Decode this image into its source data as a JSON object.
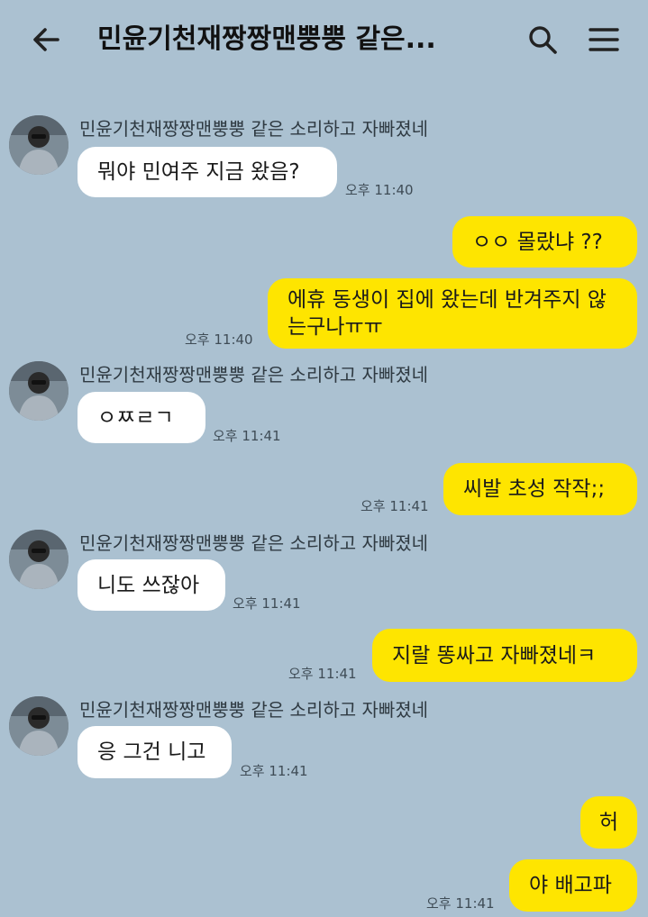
{
  "header": {
    "title": "민윤기천재짱짱맨뿡뿡 같은...",
    "back_icon": "arrow-left-icon",
    "search_icon": "search-icon",
    "menu_icon": "hamburger-menu-icon"
  },
  "colors": {
    "background": "#abc1d1",
    "incoming": "#ffffff",
    "outgoing": "#fee500"
  },
  "messages": [
    {
      "sender": "민윤기천재짱짱맨뿡뿡 같은 소리하고 자빠졌네",
      "text": "뭐야 민여주 지금 왔음?",
      "time": "오후 11:40"
    },
    {
      "text": "ㅇㅇ 몰랐냐 ??"
    },
    {
      "text": "에휴 동생이 집에 왔는데 반겨주지 않는구나ㅠㅠ",
      "time": "오후 11:40"
    },
    {
      "sender": "민윤기천재짱짱맨뿡뿡 같은 소리하고 자빠졌네",
      "text": "ㅇㅉㄹㄱ",
      "time": "오후 11:41"
    },
    {
      "text": "씨발 초성 작작;;",
      "time": "오후 11:41"
    },
    {
      "sender": "민윤기천재짱짱맨뿡뿡 같은 소리하고 자빠졌네",
      "text": "니도 쓰잖아",
      "time": "오후 11:41"
    },
    {
      "text": "지랄 똥싸고 자빠졌네ㅋ",
      "time": "오후 11:41"
    },
    {
      "sender": "민윤기천재짱짱맨뿡뿡 같은 소리하고 자빠졌네",
      "text": "응 그건 니고",
      "time": "오후 11:41"
    },
    {
      "text": "허"
    },
    {
      "text": "야 배고파",
      "time": "오후 11:41"
    }
  ]
}
